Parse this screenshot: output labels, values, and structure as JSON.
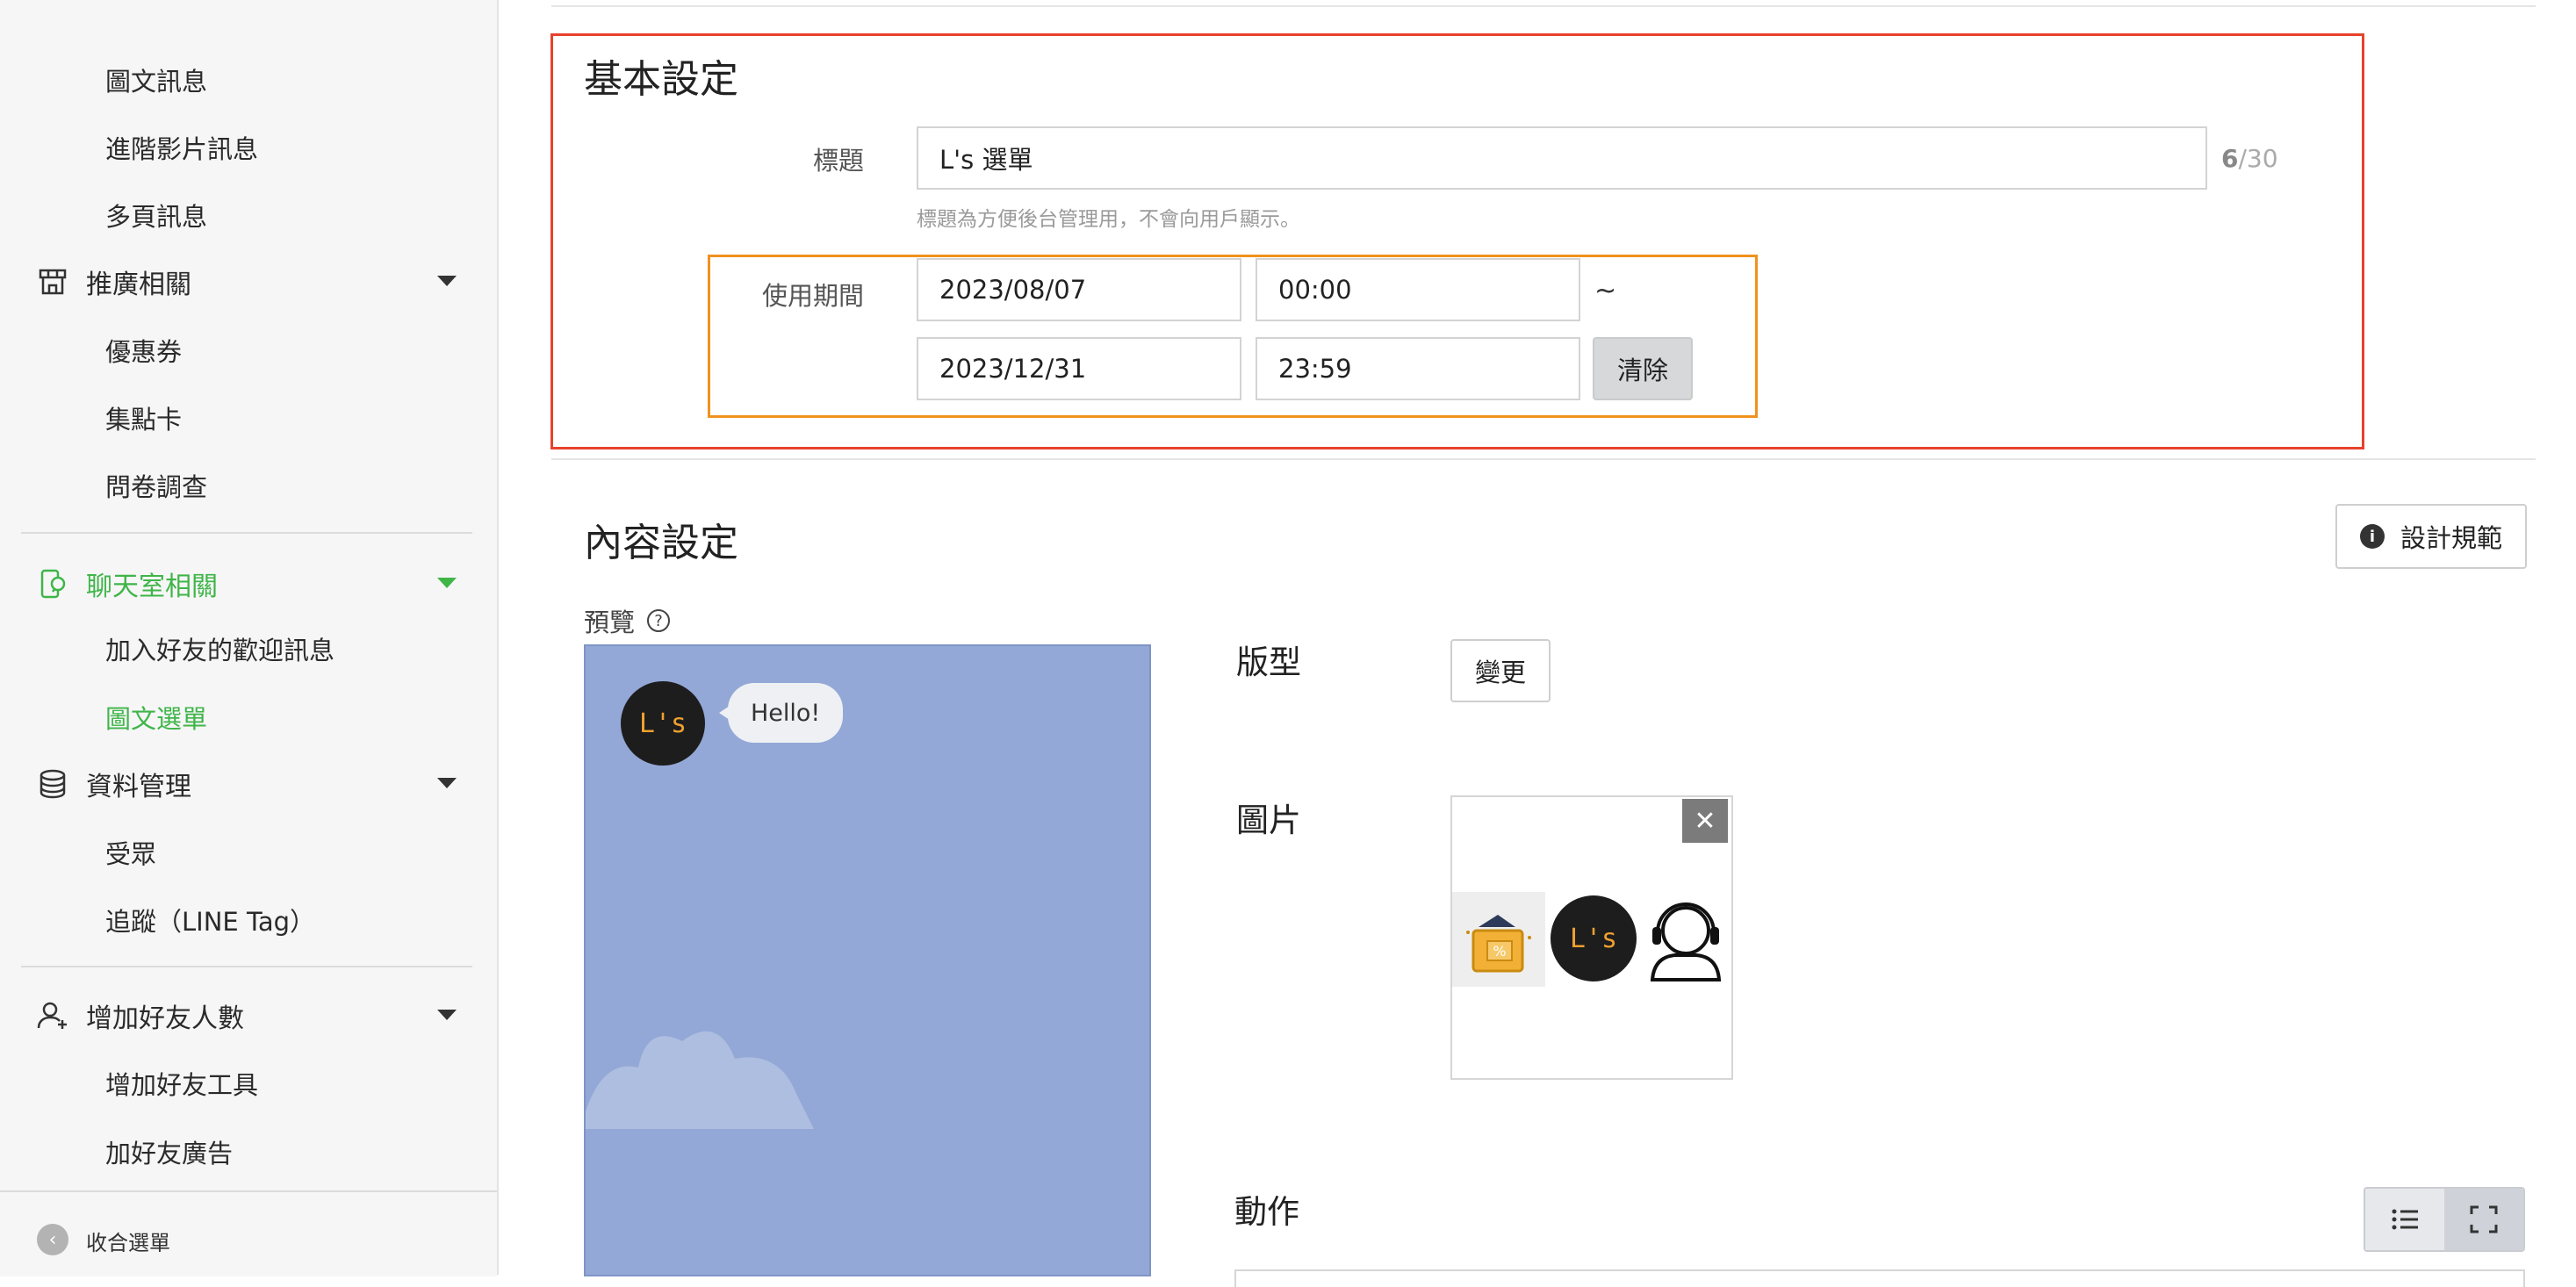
{
  "sidebar": {
    "top_items": [
      "圖文訊息",
      "進階影片訊息",
      "多頁訊息"
    ],
    "groups": [
      {
        "label": "推廣相關",
        "icon": "shop-icon",
        "items": [
          "優惠券",
          "集點卡",
          "問卷調查"
        ]
      },
      {
        "label": "聊天室相關",
        "icon": "chat-phone-icon",
        "items": [
          "加入好友的歡迎訊息",
          "圖文選單"
        ],
        "active": true,
        "active_item": "圖文選單"
      },
      {
        "label": "資料管理",
        "icon": "database-icon",
        "items": [
          "受眾",
          "追蹤（LINE Tag）"
        ]
      },
      {
        "label": "增加好友人數",
        "icon": "add-user-icon",
        "items": [
          "增加好友工具",
          "加好友廣告"
        ]
      }
    ],
    "collapse_label": "收合選單"
  },
  "basic": {
    "heading": "基本設定",
    "title_label": "標題",
    "title_value": "L's 選單",
    "counter_current": "6",
    "counter_max": "/30",
    "title_hint": "標題為方便後台管理用，不會向用戶顯示。",
    "period_label": "使用期間",
    "start_date": "2023/08/07",
    "start_time": "00:00",
    "tilde": "~",
    "end_date": "2023/12/31",
    "end_time": "23:59",
    "clear_label": "清除"
  },
  "content": {
    "heading": "內容設定",
    "design_button": "設計規範",
    "preview_label": "預覽",
    "avatar_text": "L's",
    "bubble_text": "Hello!",
    "layout_label": "版型",
    "change_button": "變更",
    "image_label": "圖片",
    "close_symbol": "✕",
    "action_label": "動作"
  },
  "colors": {
    "accent_green": "#3fb548",
    "highlight_red": "#e8412c",
    "highlight_orange": "#f0921e",
    "preview_bg": "#93a8d6"
  }
}
